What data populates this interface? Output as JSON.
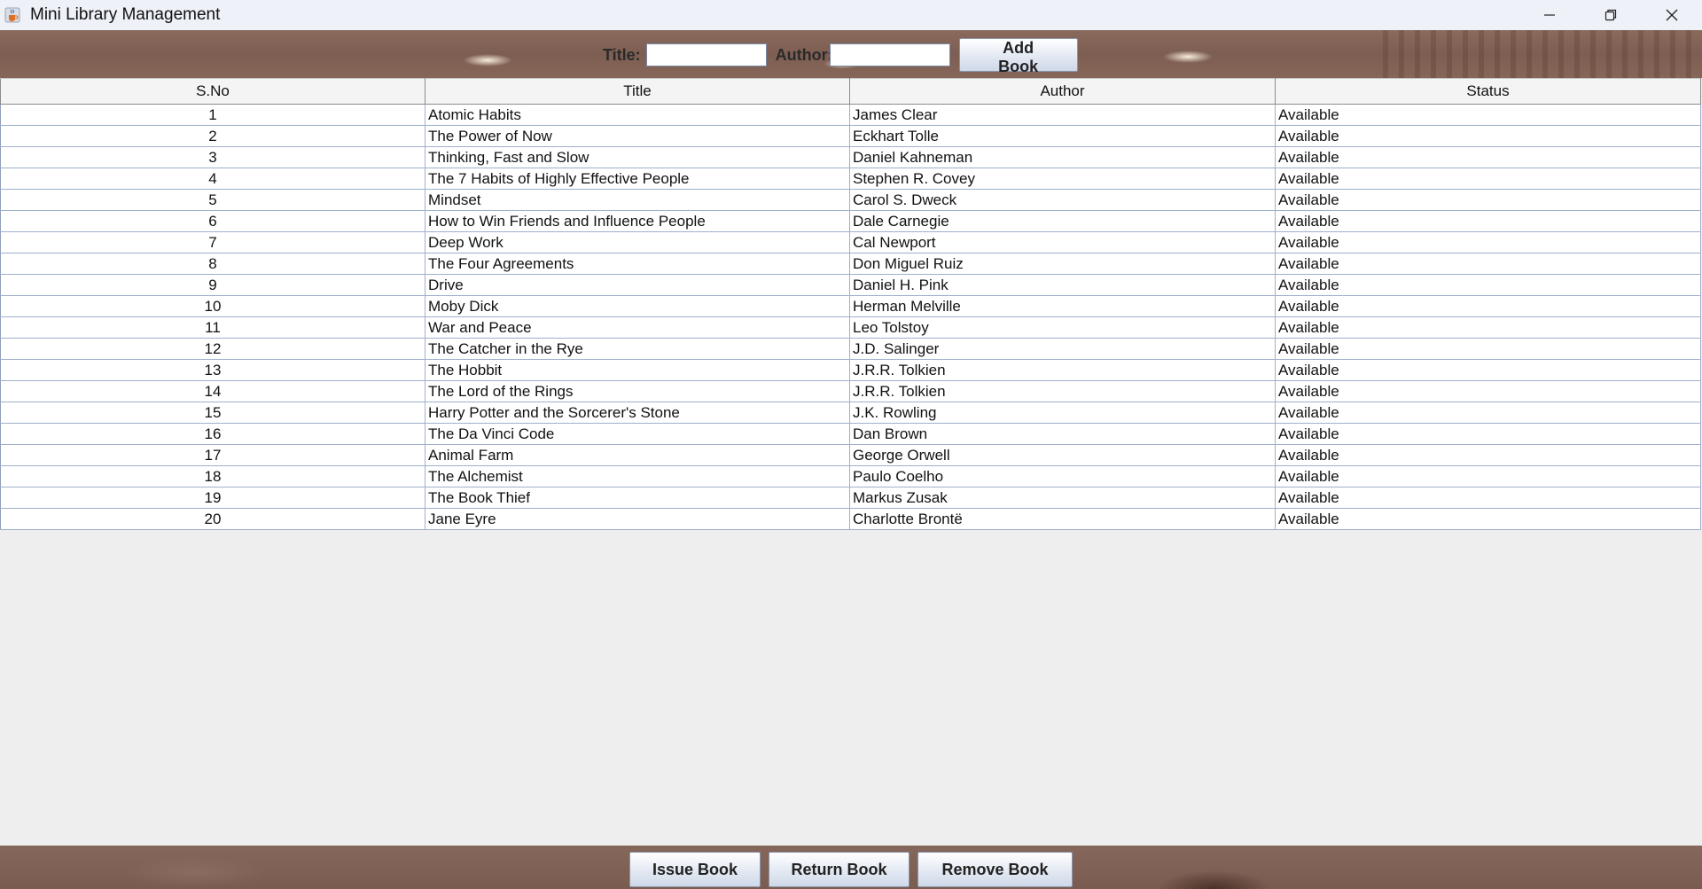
{
  "window": {
    "title": "Mini Library Management"
  },
  "top_form": {
    "title_label": "Title:",
    "title_value": "",
    "author_label": "Author:",
    "author_value": "",
    "add_button": "Add Book"
  },
  "table": {
    "columns": [
      "S.No",
      "Title",
      "Author",
      "Status"
    ],
    "rows": [
      [
        "1",
        "Atomic Habits",
        "James Clear",
        "Available"
      ],
      [
        "2",
        "The Power of Now",
        "Eckhart Tolle",
        "Available"
      ],
      [
        "3",
        "Thinking, Fast and Slow",
        "Daniel Kahneman",
        "Available"
      ],
      [
        "4",
        "The 7 Habits of Highly Effective People",
        "Stephen R. Covey",
        "Available"
      ],
      [
        "5",
        "Mindset",
        "Carol S. Dweck",
        "Available"
      ],
      [
        "6",
        "How to Win Friends and Influence People",
        "Dale Carnegie",
        "Available"
      ],
      [
        "7",
        "Deep Work",
        "Cal Newport",
        "Available"
      ],
      [
        "8",
        "The Four Agreements",
        "Don Miguel Ruiz",
        "Available"
      ],
      [
        "9",
        "Drive",
        "Daniel H. Pink",
        "Available"
      ],
      [
        "10",
        "Moby Dick",
        "Herman Melville",
        "Available"
      ],
      [
        "11",
        "War and Peace",
        "Leo Tolstoy",
        "Available"
      ],
      [
        "12",
        "The Catcher in the Rye",
        "J.D. Salinger",
        "Available"
      ],
      [
        "13",
        "The Hobbit",
        "J.R.R. Tolkien",
        "Available"
      ],
      [
        "14",
        "The Lord of the Rings",
        "J.R.R. Tolkien",
        "Available"
      ],
      [
        "15",
        "Harry Potter and the Sorcerer's Stone",
        "J.K. Rowling",
        "Available"
      ],
      [
        "16",
        "The Da Vinci Code",
        "Dan Brown",
        "Available"
      ],
      [
        "17",
        "Animal Farm",
        "George Orwell",
        "Available"
      ],
      [
        "18",
        "The Alchemist",
        "Paulo Coelho",
        "Available"
      ],
      [
        "19",
        "The Book Thief",
        "Markus Zusak",
        "Available"
      ],
      [
        "20",
        "Jane Eyre",
        "Charlotte Brontë",
        "Available"
      ]
    ]
  },
  "bottom_buttons": {
    "issue": "Issue Book",
    "return": "Return Book",
    "remove": "Remove Book"
  },
  "icons": {
    "app": "java-cup-icon",
    "minimize": "minimize-icon",
    "restore": "restore-icon",
    "close": "close-icon"
  }
}
